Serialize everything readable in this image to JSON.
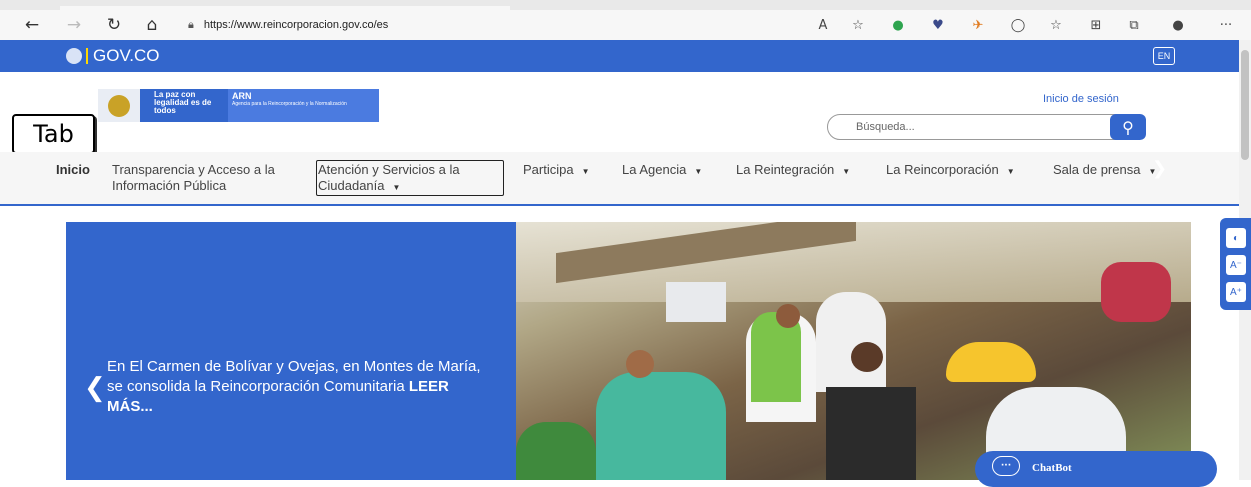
{
  "browser": {
    "back_icon": "back-arrow-icon",
    "forward_icon": "forward-arrow-icon",
    "refresh_icon": "refresh-icon",
    "home_icon": "home-icon",
    "url": "https://www.reincorporacion.gov.co/es",
    "more_label": "···"
  },
  "gov_bar": {
    "logo_text": "GOV.CO",
    "language_label": "EN",
    "color": "#3366cc"
  },
  "header": {
    "slogan": "La paz con legalidad es de todos",
    "agency_short": "ARN",
    "agency_full": "Agencia para la Reincorporación y la Normalización",
    "login_label": "Inicio de sesión",
    "search_placeholder": "Búsqueda...",
    "tab_key_label": "Tab"
  },
  "menu": {
    "home": "Inicio",
    "items": [
      {
        "label": "Transparencia y Acceso a la Información Pública"
      },
      {
        "label": "Atención y Servicios a la Ciudadanía"
      },
      {
        "label": "Participa"
      },
      {
        "label": "La Agencia"
      },
      {
        "label": "La Reintegración"
      },
      {
        "label": "La Reincorporación"
      },
      {
        "label": "Sala de prensa"
      }
    ]
  },
  "hero": {
    "caption": "En El Carmen de Bolívar y Ovejas, en Montes de María, se consolida la Reincorporación Comunitaria",
    "read_more": "LEER MÁS...",
    "prev_icon": "chevron-left-icon",
    "next_icon": "chevron-right-icon"
  },
  "accessibility": {
    "contrast": "◐",
    "font_down": "A⁻",
    "font_up": "A⁺"
  },
  "chatbot": {
    "label": "ChatBot"
  }
}
